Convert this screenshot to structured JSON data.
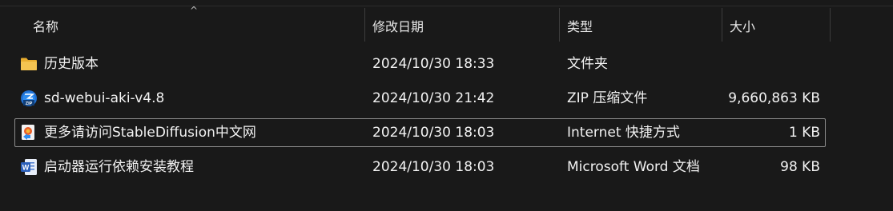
{
  "columns": {
    "name": "名称",
    "modified": "修改日期",
    "type": "类型",
    "size": "大小",
    "sort_indicator": "^"
  },
  "files": [
    {
      "icon": "folder-icon",
      "name": "历史版本",
      "modified": "2024/10/30 18:33",
      "type": "文件夹",
      "size": ""
    },
    {
      "icon": "zip-archive-icon",
      "name": "sd-webui-aki-v4.8",
      "modified": "2024/10/30 21:42",
      "type": "ZIP 压缩文件",
      "size": "9,660,863 KB"
    },
    {
      "icon": "internet-shortcut-icon",
      "name": "更多请访问StableDiffusion中文网",
      "modified": "2024/10/30 18:03",
      "type": "Internet 快捷方式",
      "size": "1 KB"
    },
    {
      "icon": "word-document-icon",
      "name": "启动器运行依赖安装教程",
      "modified": "2024/10/30 18:03",
      "type": "Microsoft Word 文档",
      "size": "98 KB"
    }
  ],
  "colors": {
    "background": "#191919",
    "text": "#f2f2f2",
    "folder": "#f5c451",
    "zip": "#2d8cf0",
    "word": "#2b5fb9",
    "focus_border": "#8b8b8b"
  }
}
